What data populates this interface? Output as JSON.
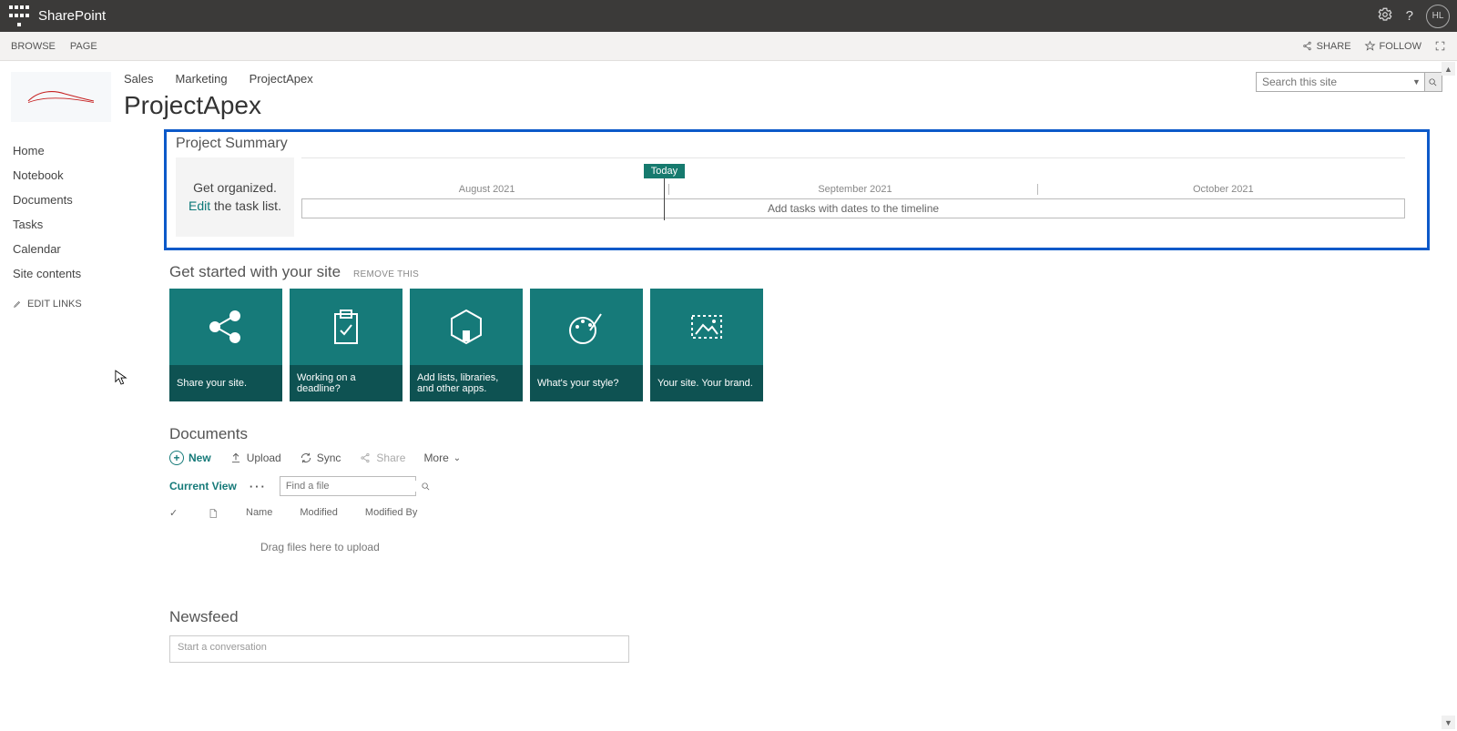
{
  "suite": {
    "brand": "SharePoint",
    "avatar": "HL"
  },
  "ribbon": {
    "tabs": [
      "BROWSE",
      "PAGE"
    ],
    "share": "SHARE",
    "follow": "FOLLOW"
  },
  "breadcrumbs": {
    "items": [
      "Sales",
      "Marketing",
      "ProjectApex"
    ]
  },
  "page_title": "ProjectApex",
  "search": {
    "placeholder": "Search this site"
  },
  "leftnav": {
    "items": [
      "Home",
      "Notebook",
      "Documents",
      "Tasks",
      "Calendar",
      "Site contents"
    ],
    "edit_links": "EDIT LINKS"
  },
  "project_summary": {
    "title": "Project Summary",
    "organize_line1": "Get organized.",
    "organize_edit": "Edit",
    "organize_line2": " the task list.",
    "today": "Today",
    "months": [
      "August 2021",
      "September 2021",
      "October 2021"
    ],
    "timeline_hint": "Add tasks with dates to the timeline"
  },
  "get_started": {
    "title": "Get started with your site",
    "remove": "REMOVE THIS",
    "tiles": [
      "Share your site.",
      "Working on a deadline?",
      "Add lists, libraries, and other apps.",
      "What's your style?",
      "Your site. Your brand."
    ]
  },
  "documents": {
    "title": "Documents",
    "new": "New",
    "upload": "Upload",
    "sync": "Sync",
    "share": "Share",
    "more": "More",
    "current_view": "Current View",
    "find_file_placeholder": "Find a file",
    "cols": {
      "name": "Name",
      "modified": "Modified",
      "modified_by": "Modified By"
    },
    "drag_hint": "Drag files here to upload"
  },
  "newsfeed": {
    "title": "Newsfeed",
    "placeholder": "Start a conversation"
  }
}
